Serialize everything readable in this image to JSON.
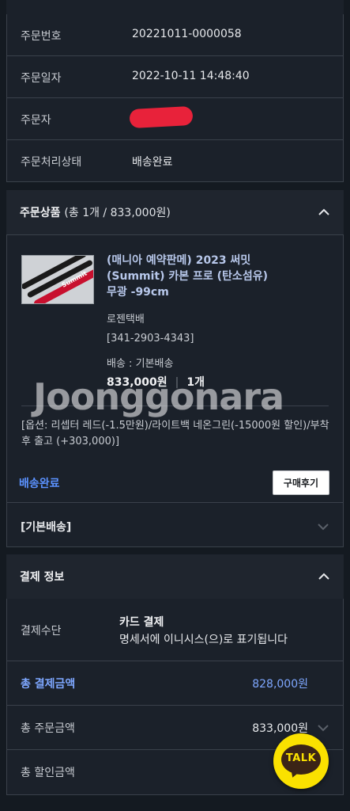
{
  "order_info": [
    {
      "label": "주문번호",
      "value": "20221011-0000058"
    },
    {
      "label": "주문일자",
      "value": "2022-10-11 14:48:40"
    },
    {
      "label": "주문자",
      "value": ""
    },
    {
      "label": "주문처리상태",
      "value": "배송완료"
    }
  ],
  "products_section": {
    "title": "주문상품",
    "summary": "(총 1개 / 833,000원)"
  },
  "product": {
    "name": "(매니아 예약판메) 2023 써밋 (Summit) 카본 프로 (탄소섬유) 무광 -99cm",
    "courier": "로젠택배",
    "tracking": "[341-2903-4343]",
    "shipping": "배송 : 기본배송",
    "price": "833,000원",
    "quantity": "1개",
    "options": "[옵션: 리셉터 레드(-1.5만원)/라이트백 네온그린(-15000원 할인)/부착후 출고 (+303,000)]",
    "status": "배송완료",
    "review_button": "구매후기",
    "shipping_group": "[기본배송]",
    "thumb_text": "Summit"
  },
  "watermark": "Joonggonara",
  "payment_section": {
    "title": "결제 정보",
    "method_label": "결제수단",
    "method_name": "카드 결제",
    "method_note": "명세서에 이니시스(으)로 표기됩니다",
    "total_label": "총 결제금액",
    "total_value": "828,000원",
    "order_total_label": "총 주문금액",
    "order_total_value": "833,000원",
    "discount_label": "총 할인금액"
  },
  "kakao_talk": "TALK",
  "colors": {
    "background": "#141a21",
    "accent_blue": "#5b92ff",
    "kakao_yellow": "#fae100"
  }
}
